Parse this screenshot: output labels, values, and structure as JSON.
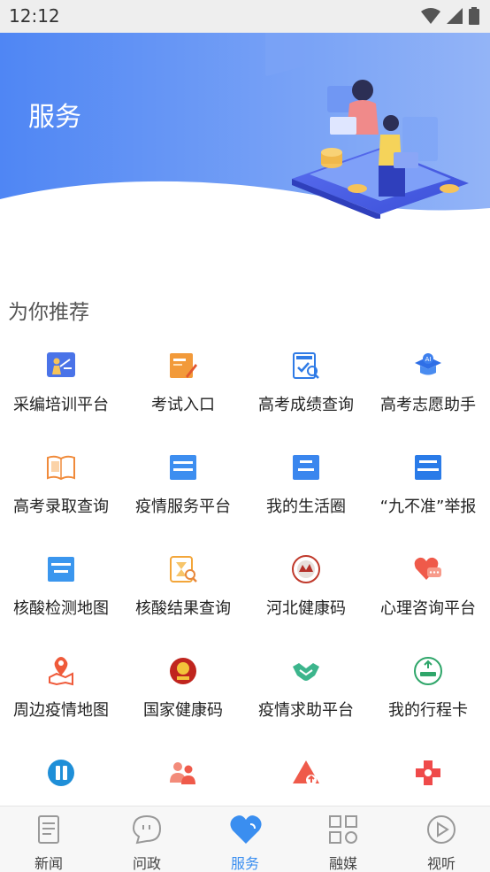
{
  "status": {
    "time": "12:12"
  },
  "banner": {
    "title": "服务"
  },
  "section": {
    "title": "为你推荐"
  },
  "services": [
    {
      "label": "采编培训平台",
      "icon": "training-icon"
    },
    {
      "label": "考试入口",
      "icon": "exam-icon"
    },
    {
      "label": "高考成绩查询",
      "icon": "score-query-icon"
    },
    {
      "label": "高考志愿助手",
      "icon": "ai-cap-icon"
    },
    {
      "label": "高考录取查询",
      "icon": "admission-book-icon"
    },
    {
      "label": "疫情服务平台",
      "icon": "epidemic-service-icon"
    },
    {
      "label": "我的生活圈",
      "icon": "life-circle-icon"
    },
    {
      "label": "“九不准”举报",
      "icon": "report-icon"
    },
    {
      "label": "核酸检测地图",
      "icon": "test-map-icon"
    },
    {
      "label": "核酸结果查询",
      "icon": "result-query-icon"
    },
    {
      "label": "河北健康码",
      "icon": "hebei-health-code-icon"
    },
    {
      "label": "心理咨询平台",
      "icon": "heart-chat-icon"
    },
    {
      "label": "周边疫情地图",
      "icon": "location-map-icon"
    },
    {
      "label": "国家健康码",
      "icon": "national-emblem-icon"
    },
    {
      "label": "疫情求助平台",
      "icon": "handshake-icon"
    },
    {
      "label": "我的行程卡",
      "icon": "itinerary-card-icon"
    },
    {
      "label": "",
      "icon": "vaccine-icon"
    },
    {
      "label": "",
      "icon": "people-icon"
    },
    {
      "label": "",
      "icon": "warning-icon"
    },
    {
      "label": "",
      "icon": "medical-cross-icon"
    }
  ],
  "tabs": [
    {
      "label": "新闻",
      "icon": "news-icon",
      "active": false
    },
    {
      "label": "问政",
      "icon": "chat-bubble-icon",
      "active": false
    },
    {
      "label": "服务",
      "icon": "heart-icon",
      "active": true
    },
    {
      "label": "融媒",
      "icon": "grid-icon",
      "active": false
    },
    {
      "label": "视听",
      "icon": "play-icon",
      "active": false
    }
  ],
  "colors": {
    "accent": "#3a8ef0",
    "banner_start": "#4f86f4",
    "banner_end": "#8fb1f8"
  }
}
